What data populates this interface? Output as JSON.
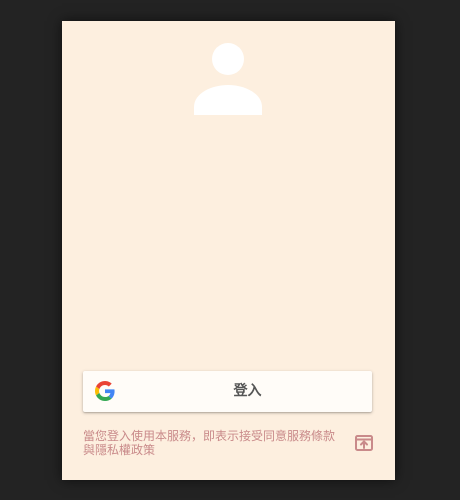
{
  "login": {
    "avatar_icon": "person-icon",
    "signin_button": {
      "icon": "google-g-icon",
      "label": "登入"
    },
    "terms_text": "當您登入使用本服務，即表示接受同意服務條款與隱私權政策",
    "open_icon": "open-in-new-icon"
  },
  "colors": {
    "background": "#232323",
    "card": "#fdefdf",
    "button": "#fffcf8",
    "terms_text": "#c98a8a",
    "avatar": "#ffffff"
  }
}
